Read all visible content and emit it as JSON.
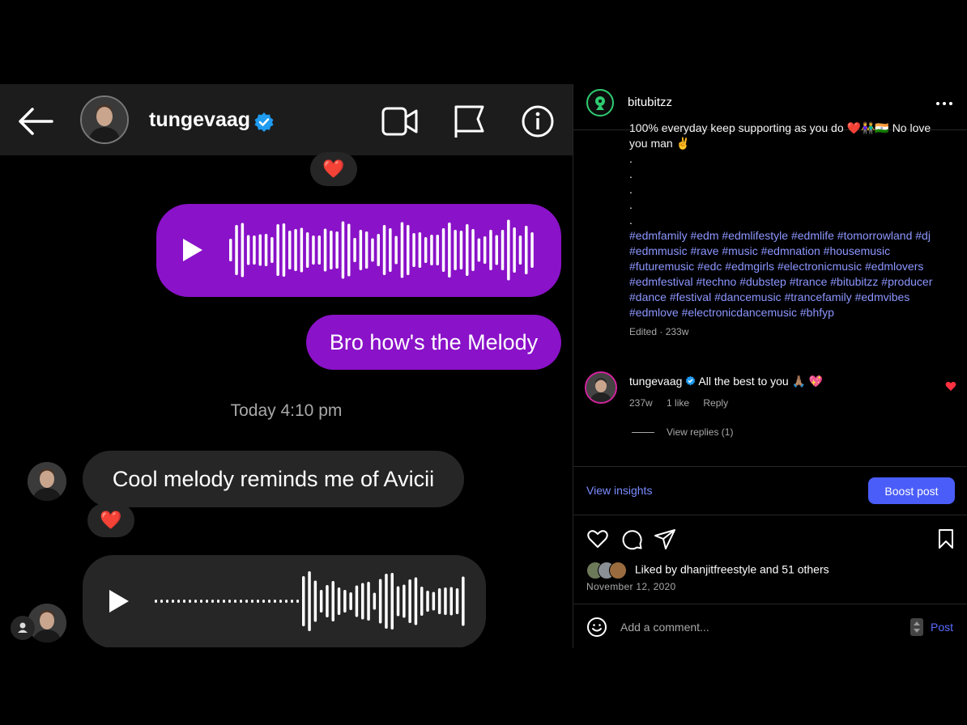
{
  "dm": {
    "contact_name": "tungevaag",
    "outgoing_text": "Bro how's the Melody",
    "timestamp": "Today 4:10 pm",
    "incoming_text": "Cool melody reminds me of Avicii",
    "reaction_emoji": "❤️"
  },
  "post": {
    "username": "bitubitzz",
    "caption_lines": [
      "100% everyday keep supporting as you do ❤️👫🇮🇳 No love",
      "you man ✌️"
    ],
    "dots": [
      ".",
      ".",
      ".",
      ".",
      "."
    ],
    "hashtag_lines": [
      "#edmfamily #edm #edmlifestyle #edmlife #tomorrowland #dj",
      "#edmmusic #rave #music #edmnation #housemusic",
      "#futuremusic #edc #edmgirls #electronicmusic #edmlovers",
      "#edmfestival #techno #dubstep #trance #bitubitzz #producer",
      "#dance #festival #dancemusic #trancefamily #edmvibes",
      "#edmlove #electronicdancemusic #bhfyp"
    ],
    "edited_meta": "Edited · 233w",
    "comment": {
      "author": "tungevaag",
      "text": "All the best to you 🙏🏽 💖",
      "age": "237w",
      "likes": "1 like",
      "reply_label": "Reply",
      "view_replies": "View replies (1)"
    },
    "view_insights": "View insights",
    "boost_label": "Boost post",
    "liked_by_prefix": "Liked by",
    "liked_by_user": "dhanjitfreestyle",
    "liked_by_suffix": "and",
    "liked_by_others": "51 others",
    "date": "November 12, 2020",
    "comment_placeholder": "Add a comment...",
    "post_label": "Post"
  },
  "colors": {
    "my_bubble": "#8a12c8",
    "their_bubble": "#262626",
    "link_blue": "#8c96ff",
    "boost_blue": "#4a5df9"
  }
}
